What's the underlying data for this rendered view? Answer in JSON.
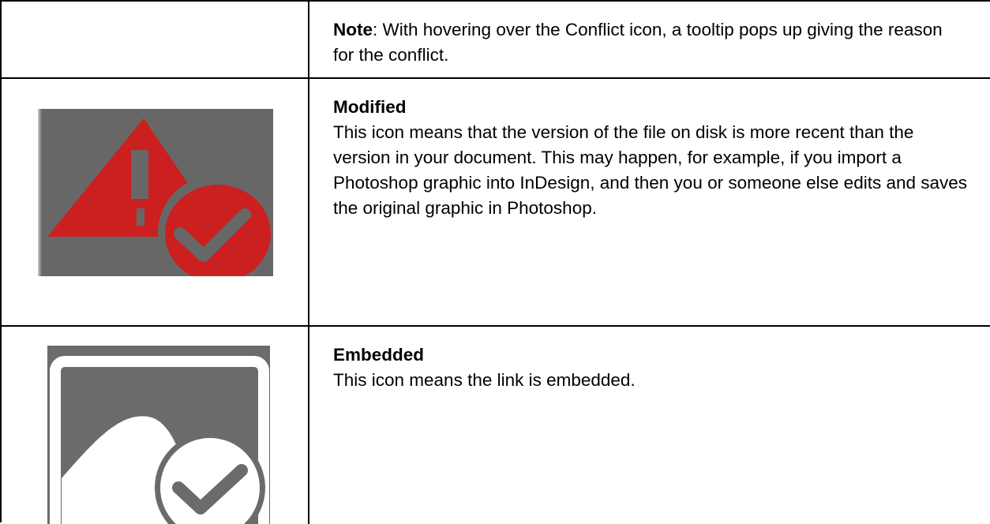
{
  "rows": [
    {
      "note_label": "Note",
      "note_text": ": With hovering over the Conflict icon, a tooltip pops up giving the reason for the conflict."
    },
    {
      "title": "Modified",
      "description": "This icon means that the version of the file on disk is more recent than the version in your document. This may happen, for example, if you import a Photoshop graphic into InDesign, and then you or someone else edits and saves the original graphic in Photoshop.",
      "icon": "modified-warning-check-icon",
      "icon_colors": {
        "background": "#676767",
        "accent": "#cc1f1f",
        "check": "#676767"
      }
    },
    {
      "title": "Embedded",
      "description": "This icon means the link is embedded.",
      "icon": "embedded-image-check-icon",
      "icon_colors": {
        "background": "#6b6b6b",
        "foreground": "#ffffff",
        "check": "#6b6b6b"
      }
    }
  ]
}
